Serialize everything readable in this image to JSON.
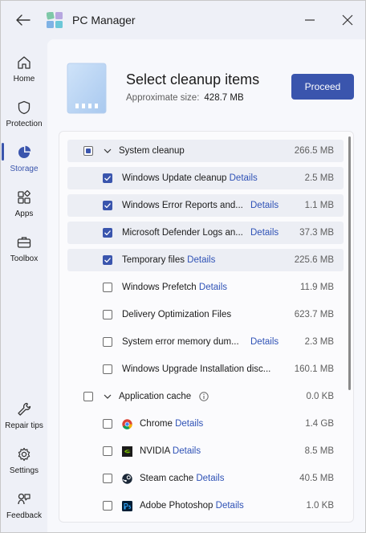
{
  "app": {
    "title": "PC Manager"
  },
  "nav": {
    "items": [
      {
        "label": "Home",
        "icon": "home-icon"
      },
      {
        "label": "Protection",
        "icon": "shield-icon"
      },
      {
        "label": "Storage",
        "icon": "pie-chart-icon",
        "active": true
      },
      {
        "label": "Apps",
        "icon": "apps-grid-icon"
      },
      {
        "label": "Toolbox",
        "icon": "toolbox-icon"
      },
      {
        "label": "Repair tips",
        "icon": "wrench-icon"
      },
      {
        "label": "Settings",
        "icon": "gear-icon"
      },
      {
        "label": "Feedback",
        "icon": "feedback-icon"
      }
    ]
  },
  "header": {
    "title": "Select cleanup items",
    "size_label": "Approximate size:",
    "size_value": "428.7 MB",
    "proceed_label": "Proceed"
  },
  "groups": [
    {
      "label": "System cleanup",
      "size": "266.5 MB",
      "state": "partial",
      "items": [
        {
          "label": "Windows Update cleanup",
          "details": "Details",
          "size": "2.5 MB",
          "checked": true
        },
        {
          "label": "Windows Error Reports and...",
          "details": "Details",
          "size": "1.1 MB",
          "checked": true
        },
        {
          "label": "Microsoft Defender Logs an...",
          "details": "Details",
          "size": "37.3 MB",
          "checked": true
        },
        {
          "label": "Temporary files",
          "details": "Details",
          "size": "225.6 MB",
          "checked": true
        },
        {
          "label": "Windows Prefetch",
          "details": "Details",
          "size": "11.9 MB",
          "checked": false
        },
        {
          "label": "Delivery Optimization Files",
          "details": "",
          "size": "623.7 MB",
          "checked": false
        },
        {
          "label": "System error memory dum...",
          "details": "Details",
          "size": "2.3 MB",
          "checked": false
        },
        {
          "label": "Windows Upgrade Installation disc...",
          "details": "",
          "size": "160.1 MB",
          "checked": false
        }
      ]
    },
    {
      "label": "Application cache",
      "size": "0.0 KB",
      "state": "unchecked",
      "items": [
        {
          "label": "Chrome",
          "details": "Details",
          "size": "1.4 GB",
          "checked": false,
          "icon": "chrome-icon"
        },
        {
          "label": "NVIDIA",
          "details": "Details",
          "size": "8.5 MB",
          "checked": false,
          "icon": "nvidia-icon"
        },
        {
          "label": "Steam cache",
          "details": "Details",
          "size": "40.5 MB",
          "checked": false,
          "icon": "steam-icon"
        },
        {
          "label": "Adobe Photoshop",
          "details": "Details",
          "size": "1.0 KB",
          "checked": false,
          "icon": "photoshop-icon"
        }
      ]
    }
  ],
  "colors": {
    "accent": "#3a55ad",
    "link": "#2f52b6"
  }
}
